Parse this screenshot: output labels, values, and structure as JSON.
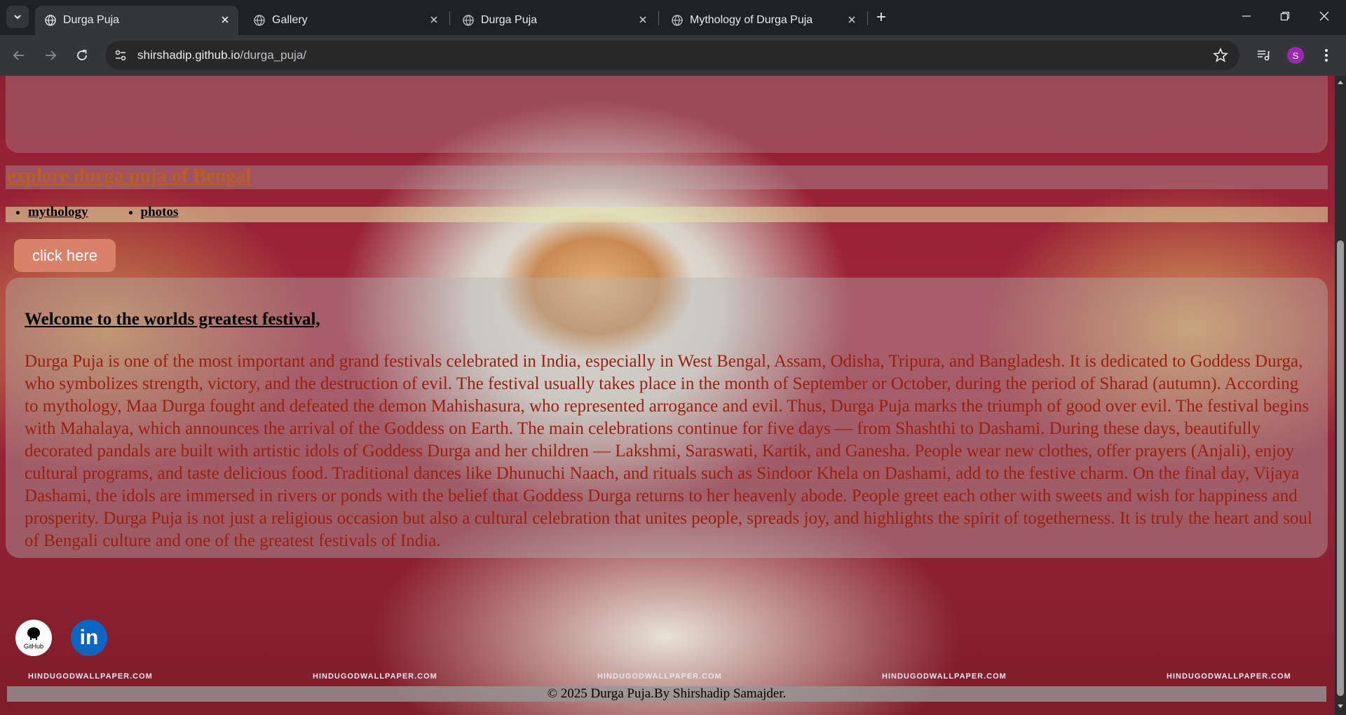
{
  "browser": {
    "tabs": [
      {
        "title": "Durga Puja",
        "active": true
      },
      {
        "title": "Gallery",
        "active": false
      },
      {
        "title": "Durga Puja",
        "active": false
      },
      {
        "title": "Mythology of Durga Puja",
        "active": false
      }
    ],
    "url_host": "shirshadip.github.io",
    "url_path": "/durga_puja/",
    "profile_initial": "S",
    "profile_color": "#9c27b0"
  },
  "page": {
    "site_heading": "explore durga puja of Bengal",
    "nav": [
      {
        "label": "mythology"
      },
      {
        "label": "photos"
      }
    ],
    "cta_label": "click here",
    "welcome": "Welcome to the worlds greatest festival,",
    "body": "Durga Puja is one of the most important and grand festivals celebrated in India, especially in West Bengal, Assam, Odisha, Tripura, and Bangladesh. It is dedicated to Goddess Durga, who symbolizes strength, victory, and the destruction of evil. The festival usually takes place in the month of September or October, during the period of Sharad (autumn). According to mythology, Maa Durga fought and defeated the demon Mahishasura, who represented arrogance and evil. Thus, Durga Puja marks the triumph of good over evil. The festival begins with Mahalaya, which announces the arrival of the Goddess on Earth. The main celebrations continue for five days — from Shashthi to Dashami. During these days, beautifully decorated pandals are built with artistic idols of Goddess Durga and her children — Lakshmi, Saraswati, Kartik, and Ganesha. People wear new clothes, offer prayers (Anjali), enjoy cultural programs, and taste delicious food. Traditional dances like Dhunuchi Naach, and rituals such as Sindoor Khela on Dashami, add to the festive charm. On the final day, Vijaya Dashami, the idols are immersed in rivers or ponds with the belief that Goddess Durga returns to her heavenly abode. People greet each other with sweets and wish for happiness and prosperity. Durga Puja is not just a religious occasion but also a cultural celebration that unites people, spreads joy, and highlights the spirit of togetherness. It is truly the heart and soul of Bengali culture and one of the greatest festivals of India.",
    "social": {
      "github_label": "GitHub",
      "linkedin_label": "in"
    },
    "watermark": "HINDUGODWALLPAPER.COM",
    "footer": "© 2025 Durga Puja.By Shirshadip Samajder."
  }
}
